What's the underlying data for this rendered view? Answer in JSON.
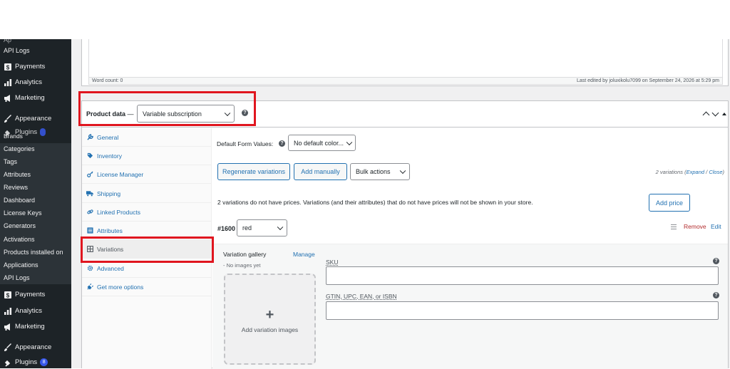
{
  "sidebar": {
    "top_partial": "API Logs",
    "menu1": [
      {
        "label": "Payments",
        "icon": "dollar-icon"
      },
      {
        "label": "Analytics",
        "icon": "bar-chart-icon"
      },
      {
        "label": "Marketing",
        "icon": "megaphone-icon"
      },
      {
        "label": "Appearance",
        "icon": "brush-icon"
      }
    ],
    "overlap_plugins": "Plugins",
    "overlap_brands": "Brands",
    "submenu": [
      "Categories",
      "Tags",
      "Attributes",
      "Reviews",
      "Dashboard",
      "License Keys",
      "Generators",
      "Activations",
      "Products installed on",
      "Applications",
      "API Logs"
    ],
    "menu2": [
      {
        "label": "Payments",
        "icon": "dollar-icon"
      },
      {
        "label": "Analytics",
        "icon": "bar-chart-icon"
      },
      {
        "label": "Marketing",
        "icon": "megaphone-icon"
      },
      {
        "label": "Appearance",
        "icon": "brush-icon"
      },
      {
        "label": "Plugins",
        "icon": "plug-icon",
        "badge": "8"
      }
    ]
  },
  "editor": {
    "word_count": "Word count: 0",
    "last_edited": "Last edited by joluxikolu7099 on September 24, 2026 at 5:29 pm"
  },
  "product_data": {
    "title": "Product data",
    "dash": "—",
    "type_selected": "Variable subscription",
    "tabs": [
      {
        "label": "General",
        "icon": "wrench-icon"
      },
      {
        "label": "Inventory",
        "icon": "tag-icon"
      },
      {
        "label": "License Manager",
        "icon": "key-icon"
      },
      {
        "label": "Shipping",
        "icon": "truck-icon"
      },
      {
        "label": "Linked Products",
        "icon": "link-icon"
      },
      {
        "label": "Attributes",
        "icon": "list-icon"
      },
      {
        "label": "Variations",
        "icon": "grid-icon",
        "active": true
      },
      {
        "label": "Advanced",
        "icon": "gear-icon"
      },
      {
        "label": "Get more options",
        "icon": "plug-icon"
      }
    ]
  },
  "variations": {
    "default_form_label": "Default Form Values:",
    "default_form_value": "No default color...",
    "regenerate_label": "Regenerate variations",
    "add_manually_label": "Add manually",
    "bulk_actions_label": "Bulk actions",
    "count_text": "2 variations",
    "expand_label": "Expand",
    "slash": " / ",
    "close_label": "Close",
    "notice": "2 variations do not have prices. Variations (and their attributes) that do not have prices will not be shown in your store.",
    "add_price_label": "Add price",
    "item_id": "#1600",
    "item_attr": "red",
    "remove_label": "Remove",
    "edit_label": "Edit",
    "gallery_title": "Variation gallery",
    "manage_label": "Manage",
    "no_images": "- No images yet",
    "add_images_label": "Add variation images",
    "sku_label": "SKU",
    "gtin_label": "GTIN, UPC, EAN, or ISBN"
  },
  "colors": {
    "accent": "#2271b1",
    "highlight": "#e0161f",
    "sidebar": "#1d2327"
  }
}
